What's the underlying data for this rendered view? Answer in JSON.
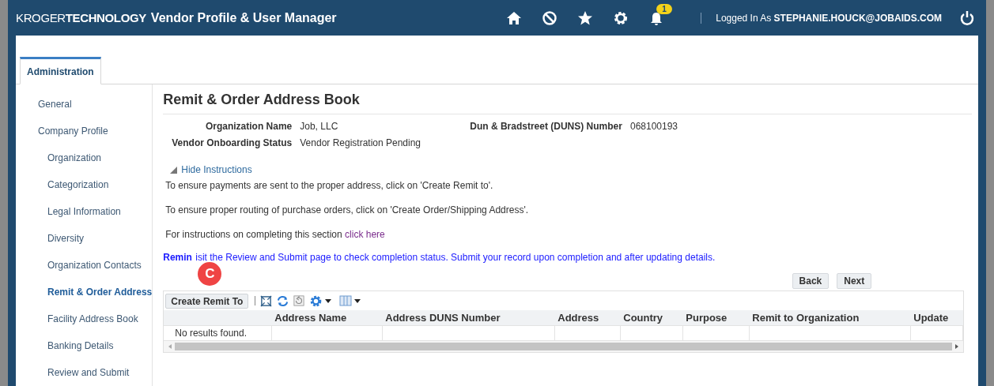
{
  "header": {
    "brand_light": "KROGER",
    "brand_bold": "TECHNOLOGY",
    "app_title": "Vendor Profile & User Manager",
    "notification_count": "1",
    "logged_in_label": "Logged In As",
    "user": "STEPHANIE.HOUCK@JOBAIDS.COM"
  },
  "tabs": [
    {
      "label": "Administration",
      "selected": true
    }
  ],
  "sidebar": {
    "items": [
      {
        "label": "General",
        "selected": false
      },
      {
        "label": "Company Profile",
        "selected": false,
        "children": [
          {
            "label": "Organization",
            "selected": false
          },
          {
            "label": "Categorization",
            "selected": false
          },
          {
            "label": "Legal Information",
            "selected": false
          },
          {
            "label": "Diversity",
            "selected": false
          },
          {
            "label": "Organization Contacts",
            "selected": false
          },
          {
            "label": "Remit & Order Address",
            "selected": true
          },
          {
            "label": "Facility Address Book",
            "selected": false
          },
          {
            "label": "Banking Details",
            "selected": false
          },
          {
            "label": "Review and Submit",
            "selected": false
          }
        ]
      }
    ]
  },
  "page": {
    "title": "Remit & Order Address Book",
    "fields": [
      {
        "label": "Organization Name",
        "value": "Job, LLC"
      },
      {
        "label": "Dun & Bradstreet (DUNS) Number",
        "value": "068100193"
      },
      {
        "label": "Vendor Onboarding Status",
        "value": "Vendor Registration Pending"
      }
    ],
    "instructions_toggle": "Hide Instructions",
    "instructions": [
      "To ensure payments are sent to the proper address, click on 'Create Remit to'.",
      "To ensure proper routing of purchase orders, click on 'Create Order/Shipping Address'."
    ],
    "help_text": "For instructions on completing this section",
    "help_link": "click here",
    "reminder_label": "Remin",
    "reminder_text": "isit the Review and Submit page to check completion status. Submit your record upon completion and after updating details.",
    "callout": "C",
    "buttons": [
      "Back",
      "Next"
    ]
  },
  "table": {
    "create_button": "Create Remit To",
    "columns": [
      "Address Name",
      "Address DUNS Number",
      "Address",
      "Country",
      "Purpose",
      "Remit to Organization",
      "Update"
    ],
    "empty_message": "No results found."
  }
}
